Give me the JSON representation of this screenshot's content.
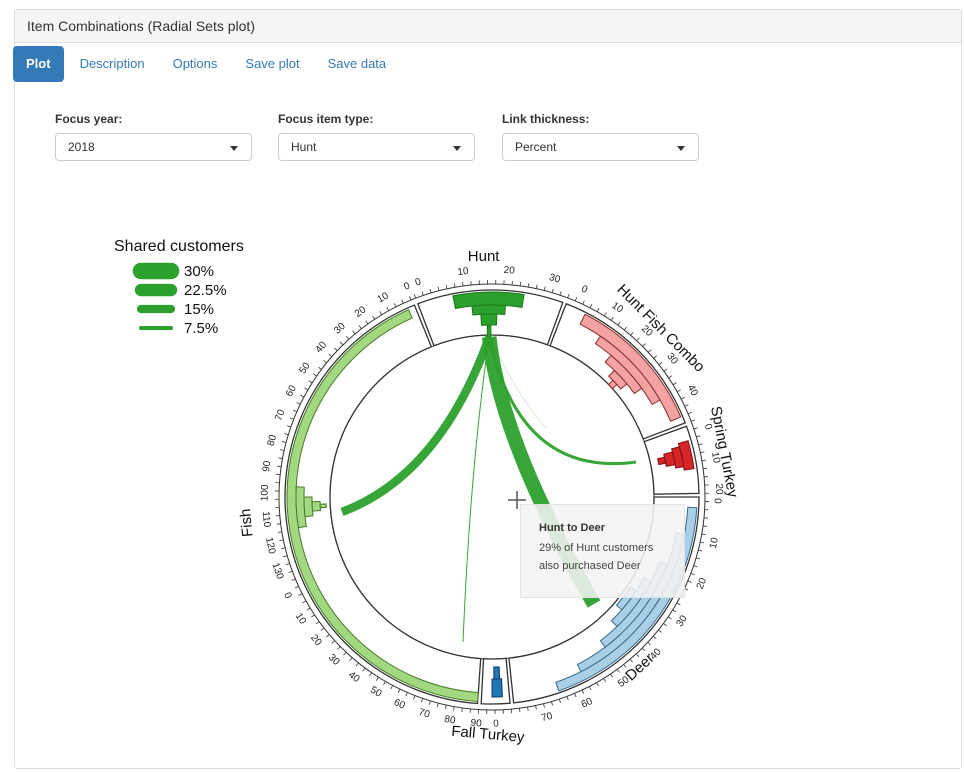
{
  "panel": {
    "title": "Item Combinations (Radial Sets plot)"
  },
  "tabs": [
    {
      "label": "Plot",
      "active": true
    },
    {
      "label": "Description"
    },
    {
      "label": "Options"
    },
    {
      "label": "Save plot"
    },
    {
      "label": "Save data"
    }
  ],
  "controls": {
    "focus_year": {
      "label": "Focus year:",
      "value": "2018"
    },
    "focus_item_type": {
      "label": "Focus item type:",
      "value": "Hunt"
    },
    "link_thickness": {
      "label": "Link thickness:",
      "value": "Percent"
    }
  },
  "legend": {
    "title": "Shared customers",
    "items": [
      {
        "label": "30%",
        "value": 30
      },
      {
        "label": "22.5%",
        "value": 22.5
      },
      {
        "label": "15%",
        "value": 15
      },
      {
        "label": "7.5%",
        "value": 7.5
      }
    ]
  },
  "tooltip": {
    "title": "Hunt to Deer",
    "line1": "29% of Hunt customers",
    "line2": "also purchased Deer"
  },
  "chart_data": {
    "type": "radial-sets",
    "focus_set": "Hunt",
    "link_color": "#2ca02c",
    "sets": [
      {
        "name": "Hunt",
        "color": "#2ca02c",
        "ticks": [
          "0",
          "10",
          "20",
          "30"
        ]
      },
      {
        "name": "Hunt Fish Combo",
        "color": "#f4a3a3",
        "ticks": [
          "0",
          "10",
          "20",
          "30",
          "40"
        ]
      },
      {
        "name": "Spring Turkey",
        "color": "#d62728",
        "ticks": [
          "0",
          "10",
          "20"
        ]
      },
      {
        "name": "Deer",
        "color": "#a8cfe6",
        "ticks": [
          "0",
          "10",
          "20",
          "30",
          "40",
          "50",
          "60",
          "70"
        ]
      },
      {
        "name": "Fall Turkey",
        "color": "#1f77b4",
        "ticks": [
          "0"
        ]
      },
      {
        "name": "Fish",
        "color": "#a1d880",
        "ticks": [
          "90",
          "80",
          "70",
          "60",
          "50",
          "40",
          "30",
          "20",
          "10",
          "0",
          "130",
          "120",
          "110",
          "100",
          "90",
          "80",
          "70",
          "60",
          "50",
          "40",
          "30",
          "20",
          "10",
          "0"
        ]
      }
    ],
    "links": [
      {
        "from": "Hunt",
        "to": "Deer",
        "percent": 29
      },
      {
        "from": "Hunt",
        "to": "Fish",
        "percent": 17
      },
      {
        "from": "Hunt",
        "to": "Spring Turkey",
        "percent": 6
      },
      {
        "from": "Hunt",
        "to": "Fall Turkey",
        "percent": 2
      },
      {
        "from": "Hunt",
        "to": "Hunt Fish Combo",
        "percent": 0.5
      }
    ]
  }
}
